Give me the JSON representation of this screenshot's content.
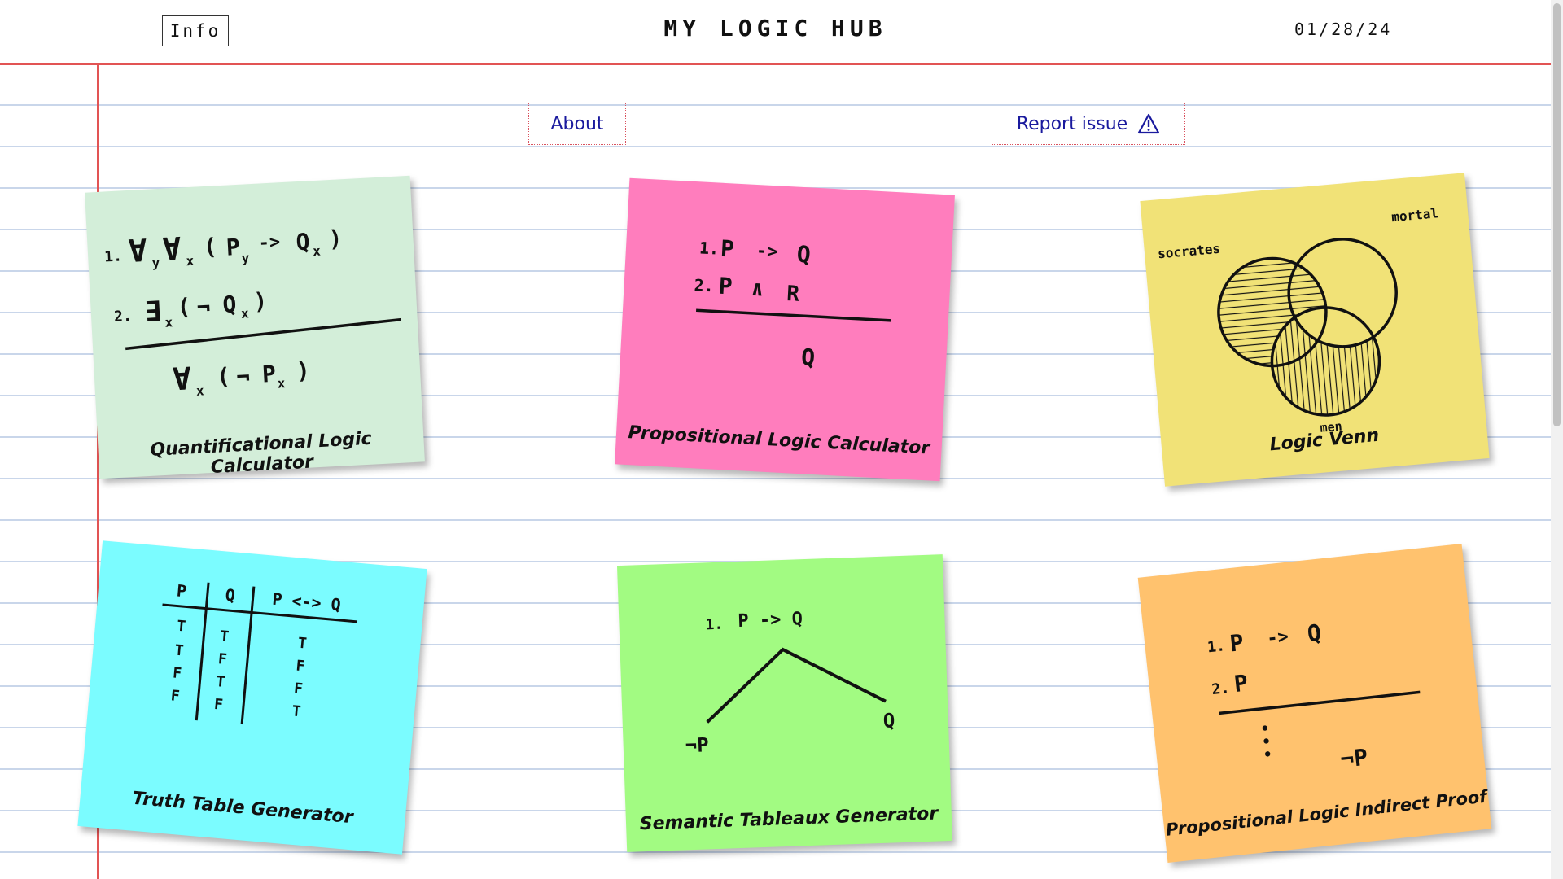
{
  "header": {
    "info_label": "Info",
    "title": "MY LOGIC HUB",
    "date": "01/28/24"
  },
  "nav": {
    "about_label": "About",
    "report_label": "Report issue"
  },
  "colors": {
    "margin_red": "#e25454",
    "link_blue": "#1a1a9e",
    "note_mint": "#d3eed9",
    "note_pink": "#ff7dbd",
    "note_yellow": "#f1e277",
    "note_cyan": "#7bfcff",
    "note_green": "#a2fb82",
    "note_orange": "#ffc26e"
  },
  "notes": [
    {
      "title": "Quantificational Logic Calculator",
      "lines": [
        "1.",
        "∀",
        "y",
        "∀",
        "x",
        "(",
        "P",
        "y",
        "->",
        "Q",
        "x",
        ")",
        "2.",
        "∃",
        "x",
        "(",
        "¬",
        "Q",
        "x",
        ")",
        "∀",
        "x",
        "(",
        "¬",
        "P",
        "x",
        ")"
      ]
    },
    {
      "title": "Propositional Logic Calculator",
      "lines": [
        "1.",
        "P",
        "->",
        "Q",
        "2.",
        "P",
        "∧",
        "R",
        "Q"
      ]
    },
    {
      "title": "Logic Venn",
      "labels": [
        "socrates",
        "mortal",
        "men"
      ]
    },
    {
      "title": "Truth Table Generator",
      "headers": [
        "P",
        "Q",
        "P <-> Q"
      ],
      "col_p": [
        "T",
        "T",
        "F",
        "F"
      ],
      "col_q": [
        "T",
        "F",
        "T",
        "F"
      ],
      "col_r": [
        "T",
        "F",
        "F",
        "T"
      ]
    },
    {
      "title": "Semantic Tableaux Generator",
      "lines": [
        "1.",
        "P -> Q",
        "¬P",
        "Q"
      ]
    },
    {
      "title": "Propositional Logic Indirect Proof",
      "lines": [
        "1.",
        "P",
        "->",
        "Q",
        "2.",
        "P",
        "¬P"
      ]
    }
  ]
}
